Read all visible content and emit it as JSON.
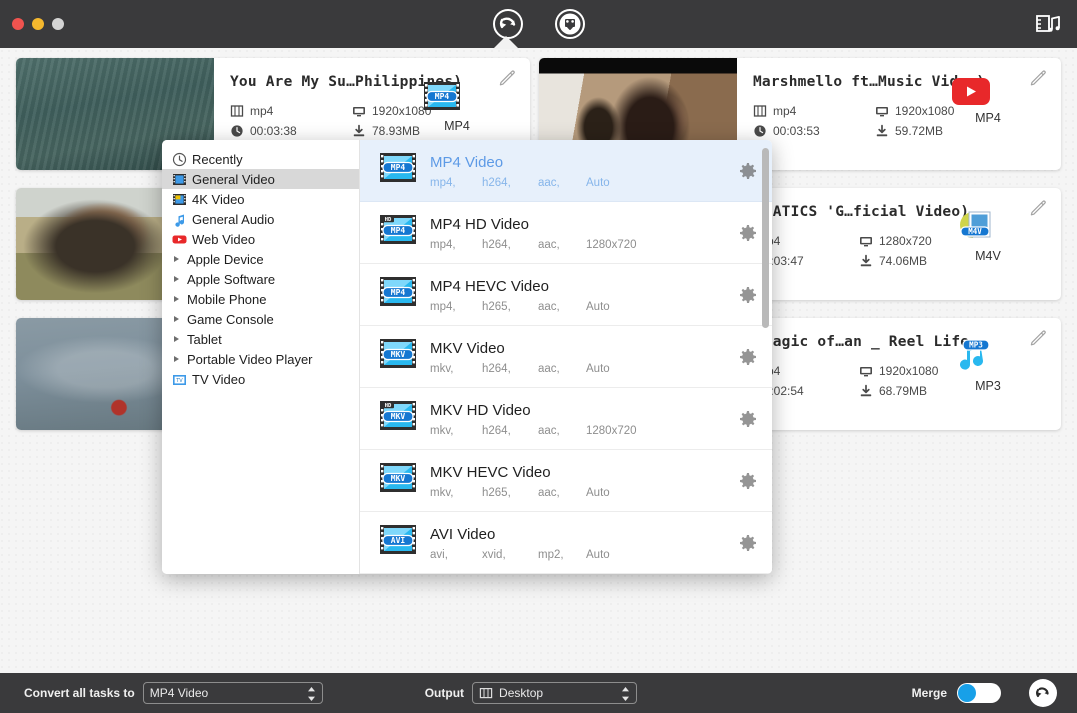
{
  "window": {
    "traffic_lights": [
      "close",
      "minimize",
      "zoom"
    ],
    "toolbar": {
      "convert_tab": "convert-icon",
      "download_tab": "download-icon",
      "toolbox_button": "media-toolbox-icon"
    }
  },
  "cards": [
    {
      "title": "You Are My Su…Philippines)",
      "format": "mp4",
      "resolution": "1920x1080",
      "duration": "00:03:38",
      "size": "78.93MB",
      "output_label": "MP4",
      "output_icon": "mp4-film-icon",
      "thumb": "t1"
    },
    {
      "title": "Marshmello ft…Music Video)",
      "format": "mp4",
      "resolution": "1920x1080",
      "duration": "00:03:53",
      "size": "59.72MB",
      "output_label": "MP4",
      "output_icon": "youtube-icon",
      "thumb": "t4"
    },
    {
      "title": "…ROMATICS 'G…ficial Video)",
      "format": "mp4",
      "resolution": "1280x720",
      "duration": "00:03:47",
      "size": "74.06MB",
      "output_label": "M4V",
      "output_icon": "m4v-icon",
      "thumb": "t2"
    },
    {
      "title": "…e Magic of…an _ Reel Life",
      "format": "mp4",
      "resolution": "1920x1080",
      "duration": "00:02:54",
      "size": "68.79MB",
      "output_label": "MP3",
      "output_icon": "mp3-note-icon",
      "thumb": "t3"
    }
  ],
  "popup": {
    "categories": [
      {
        "label": "Recently",
        "icon": "clock-icon",
        "expandable": false,
        "selected": false
      },
      {
        "label": "General Video",
        "icon": "video-icon",
        "expandable": false,
        "selected": true
      },
      {
        "label": "4K Video",
        "icon": "4k-video-icon",
        "expandable": false,
        "selected": false
      },
      {
        "label": "General Audio",
        "icon": "music-note-icon",
        "expandable": false,
        "selected": false
      },
      {
        "label": "Web Video",
        "icon": "youtube-icon",
        "expandable": false,
        "selected": false
      },
      {
        "label": "Apple Device",
        "icon": "",
        "expandable": true,
        "selected": false
      },
      {
        "label": "Apple Software",
        "icon": "",
        "expandable": true,
        "selected": false
      },
      {
        "label": "Mobile Phone",
        "icon": "",
        "expandable": true,
        "selected": false
      },
      {
        "label": "Game Console",
        "icon": "",
        "expandable": true,
        "selected": false
      },
      {
        "label": "Tablet",
        "icon": "",
        "expandable": true,
        "selected": false
      },
      {
        "label": "Portable Video Player",
        "icon": "",
        "expandable": true,
        "selected": false
      },
      {
        "label": "TV Video",
        "icon": "tv-icon",
        "expandable": false,
        "selected": false
      }
    ],
    "formats": [
      {
        "name": "MP4 Video",
        "container": "mp4,",
        "vcodec": "h264,",
        "acodec": "aac,",
        "resolution": "Auto",
        "badge": "MP4",
        "hd": false,
        "selected": true
      },
      {
        "name": "MP4 HD Video",
        "container": "mp4,",
        "vcodec": "h264,",
        "acodec": "aac,",
        "resolution": "1280x720",
        "badge": "MP4",
        "hd": true,
        "selected": false
      },
      {
        "name": "MP4 HEVC Video",
        "container": "mp4,",
        "vcodec": "h265,",
        "acodec": "aac,",
        "resolution": "Auto",
        "badge": "MP4",
        "hd": false,
        "selected": false
      },
      {
        "name": "MKV Video",
        "container": "mkv,",
        "vcodec": "h264,",
        "acodec": "aac,",
        "resolution": "Auto",
        "badge": "MKV",
        "hd": false,
        "selected": false
      },
      {
        "name": "MKV HD Video",
        "container": "mkv,",
        "vcodec": "h264,",
        "acodec": "aac,",
        "resolution": "1280x720",
        "badge": "MKV",
        "hd": true,
        "selected": false
      },
      {
        "name": "MKV HEVC Video",
        "container": "mkv,",
        "vcodec": "h265,",
        "acodec": "aac,",
        "resolution": "Auto",
        "badge": "MKV",
        "hd": false,
        "selected": false
      },
      {
        "name": "AVI Video",
        "container": "avi,",
        "vcodec": "xvid,",
        "acodec": "mp2,",
        "resolution": "Auto",
        "badge": "AVI",
        "hd": false,
        "selected": false
      }
    ]
  },
  "bottom_bar": {
    "convert_all_label": "Convert all tasks to",
    "convert_all_value": "MP4 Video",
    "output_label": "Output",
    "output_value": "Desktop",
    "merge_label": "Merge",
    "merge_on": false,
    "convert_button": "convert-icon"
  },
  "colors": {
    "titlebar": "#3a3a3c",
    "accent_blue": "#5d9ae6",
    "selected_row": "#e7f0fb",
    "toggle_knob": "#18a0e8",
    "youtube_red": "#e8282a"
  }
}
